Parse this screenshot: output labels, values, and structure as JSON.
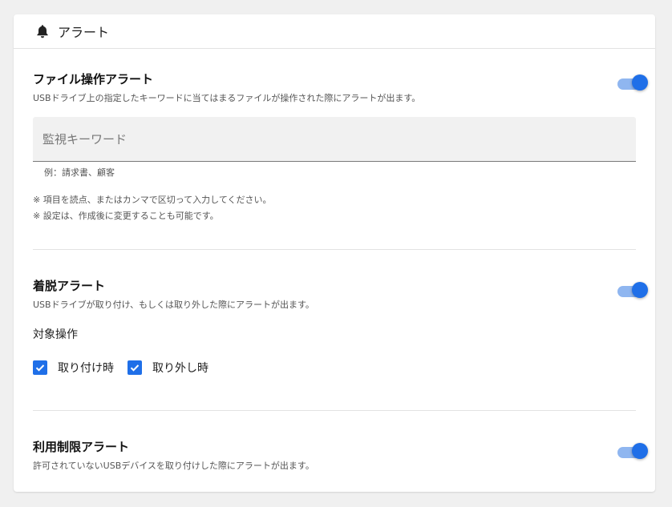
{
  "header": {
    "title": "アラート",
    "icon": "bell-icon"
  },
  "file_alert": {
    "title": "ファイル操作アラート",
    "description": "USBドライブ上の指定したキーワードに当てはまるファイルが操作された際にアラートが出ます。",
    "enabled": true,
    "keyword_field": {
      "placeholder": "監視キーワード",
      "value": ""
    },
    "example": "例：請求書、顧客",
    "notes": [
      "※ 項目を読点、またはカンマで区切って入力してください。",
      "※ 設定は、作成後に変更することも可能です。"
    ]
  },
  "attach_alert": {
    "title": "着脱アラート",
    "description": "USBドライブが取り付け、もしくは取り外した際にアラートが出ます。",
    "enabled": true,
    "target_label": "対象操作",
    "options": [
      {
        "label": "取り付け時",
        "checked": true
      },
      {
        "label": "取り外し時",
        "checked": true
      }
    ]
  },
  "usage_alert": {
    "title": "利用制限アラート",
    "description": "許可されていないUSBデバイスを取り付けした際にアラートが出ます。",
    "enabled": true
  },
  "colors": {
    "accent": "#1f6fe8",
    "toggle_track": "#8fb6f0",
    "background": "#f0f0f0",
    "card": "#ffffff"
  }
}
